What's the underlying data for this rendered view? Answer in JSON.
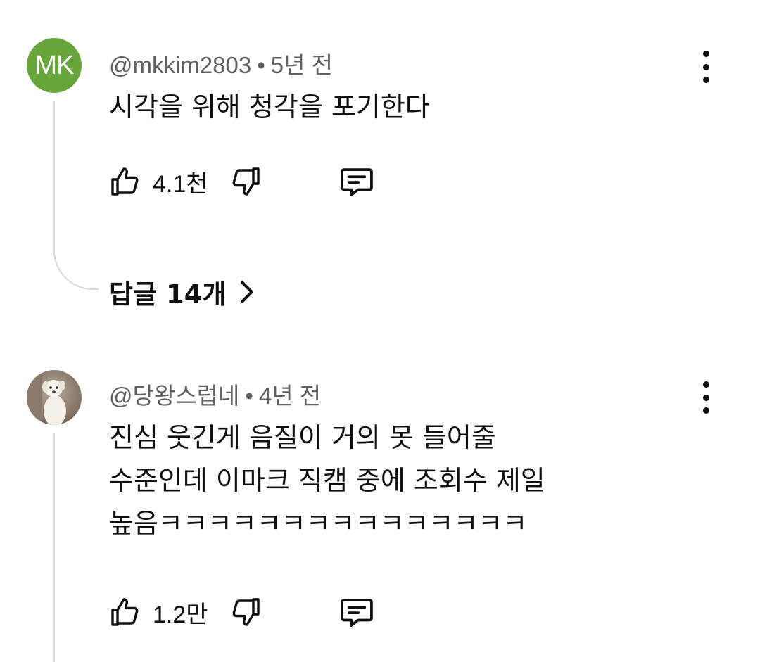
{
  "comments": [
    {
      "avatar_initials": "MK",
      "avatar_color": "#67a53b",
      "author": "@mkkim2803",
      "separator": "•",
      "time": "5년 전",
      "lines": [
        "시각을 위해 청각을 포기한다"
      ],
      "like_count": "4.1천",
      "replies_label": "답글 14개"
    },
    {
      "avatar_icon": "dog-photo-avatar",
      "author": "@당왕스럽네",
      "separator": "•",
      "time": "4년 전",
      "lines": [
        "진심 웃긴게 음질이 거의 못 들어줄",
        "수준인데 이마크 직캠 중에 조회수 제일",
        "높음ㅋㅋㅋㅋㅋㅋㅋㅋㅋㅋㅋㅋㅋㅋㅋ"
      ],
      "like_count": "1.2만"
    }
  ],
  "icons": {
    "like": "thumbs-up-icon",
    "dislike": "thumbs-down-icon",
    "reply": "reply-comment-icon",
    "more": "more-vertical-icon",
    "chevron": "chevron-right-icon"
  }
}
